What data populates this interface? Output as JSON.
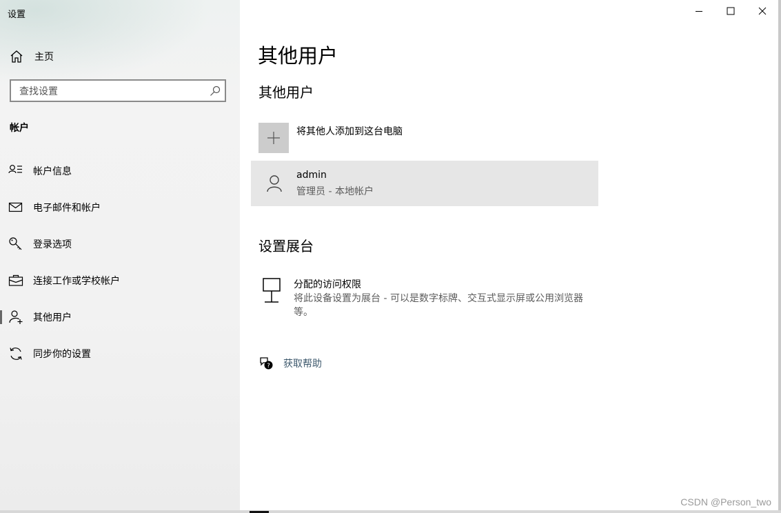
{
  "window": {
    "title": "设置",
    "controls": {
      "minimize": "minimize-icon",
      "maximize": "maximize-icon",
      "close": "close-icon"
    }
  },
  "sidebar": {
    "home_label": "主页",
    "search": {
      "placeholder": "查找设置",
      "value": ""
    },
    "section_heading": "帐户",
    "items": [
      {
        "label": "帐户信息",
        "icon": "account-info-icon"
      },
      {
        "label": "电子邮件和帐户",
        "icon": "mail-icon"
      },
      {
        "label": "登录选项",
        "icon": "key-icon"
      },
      {
        "label": "连接工作或学校帐户",
        "icon": "briefcase-icon"
      },
      {
        "label": "其他用户",
        "icon": "add-person-icon",
        "selected": true
      },
      {
        "label": "同步你的设置",
        "icon": "sync-icon"
      }
    ]
  },
  "main": {
    "page_title": "其他用户",
    "other_users_heading": "其他用户",
    "add_user_label": "将其他人添加到这台电脑",
    "account": {
      "name": "admin",
      "role": "管理员 - 本地帐户"
    },
    "kiosk_heading": "设置展台",
    "kiosk": {
      "title": "分配的访问权限",
      "description": "将此设备设置为展台 - 可以是数字标牌、交互式显示屏或公用浏览器等。"
    },
    "help_label": "获取帮助"
  },
  "watermark": "CSDN @Person_two",
  "colors": {
    "sidebar_bg": "#f2f2f2",
    "account_row_bg": "#e6e6e6",
    "add_tile_bg": "#cccccc",
    "link": "#3f5a6e"
  }
}
